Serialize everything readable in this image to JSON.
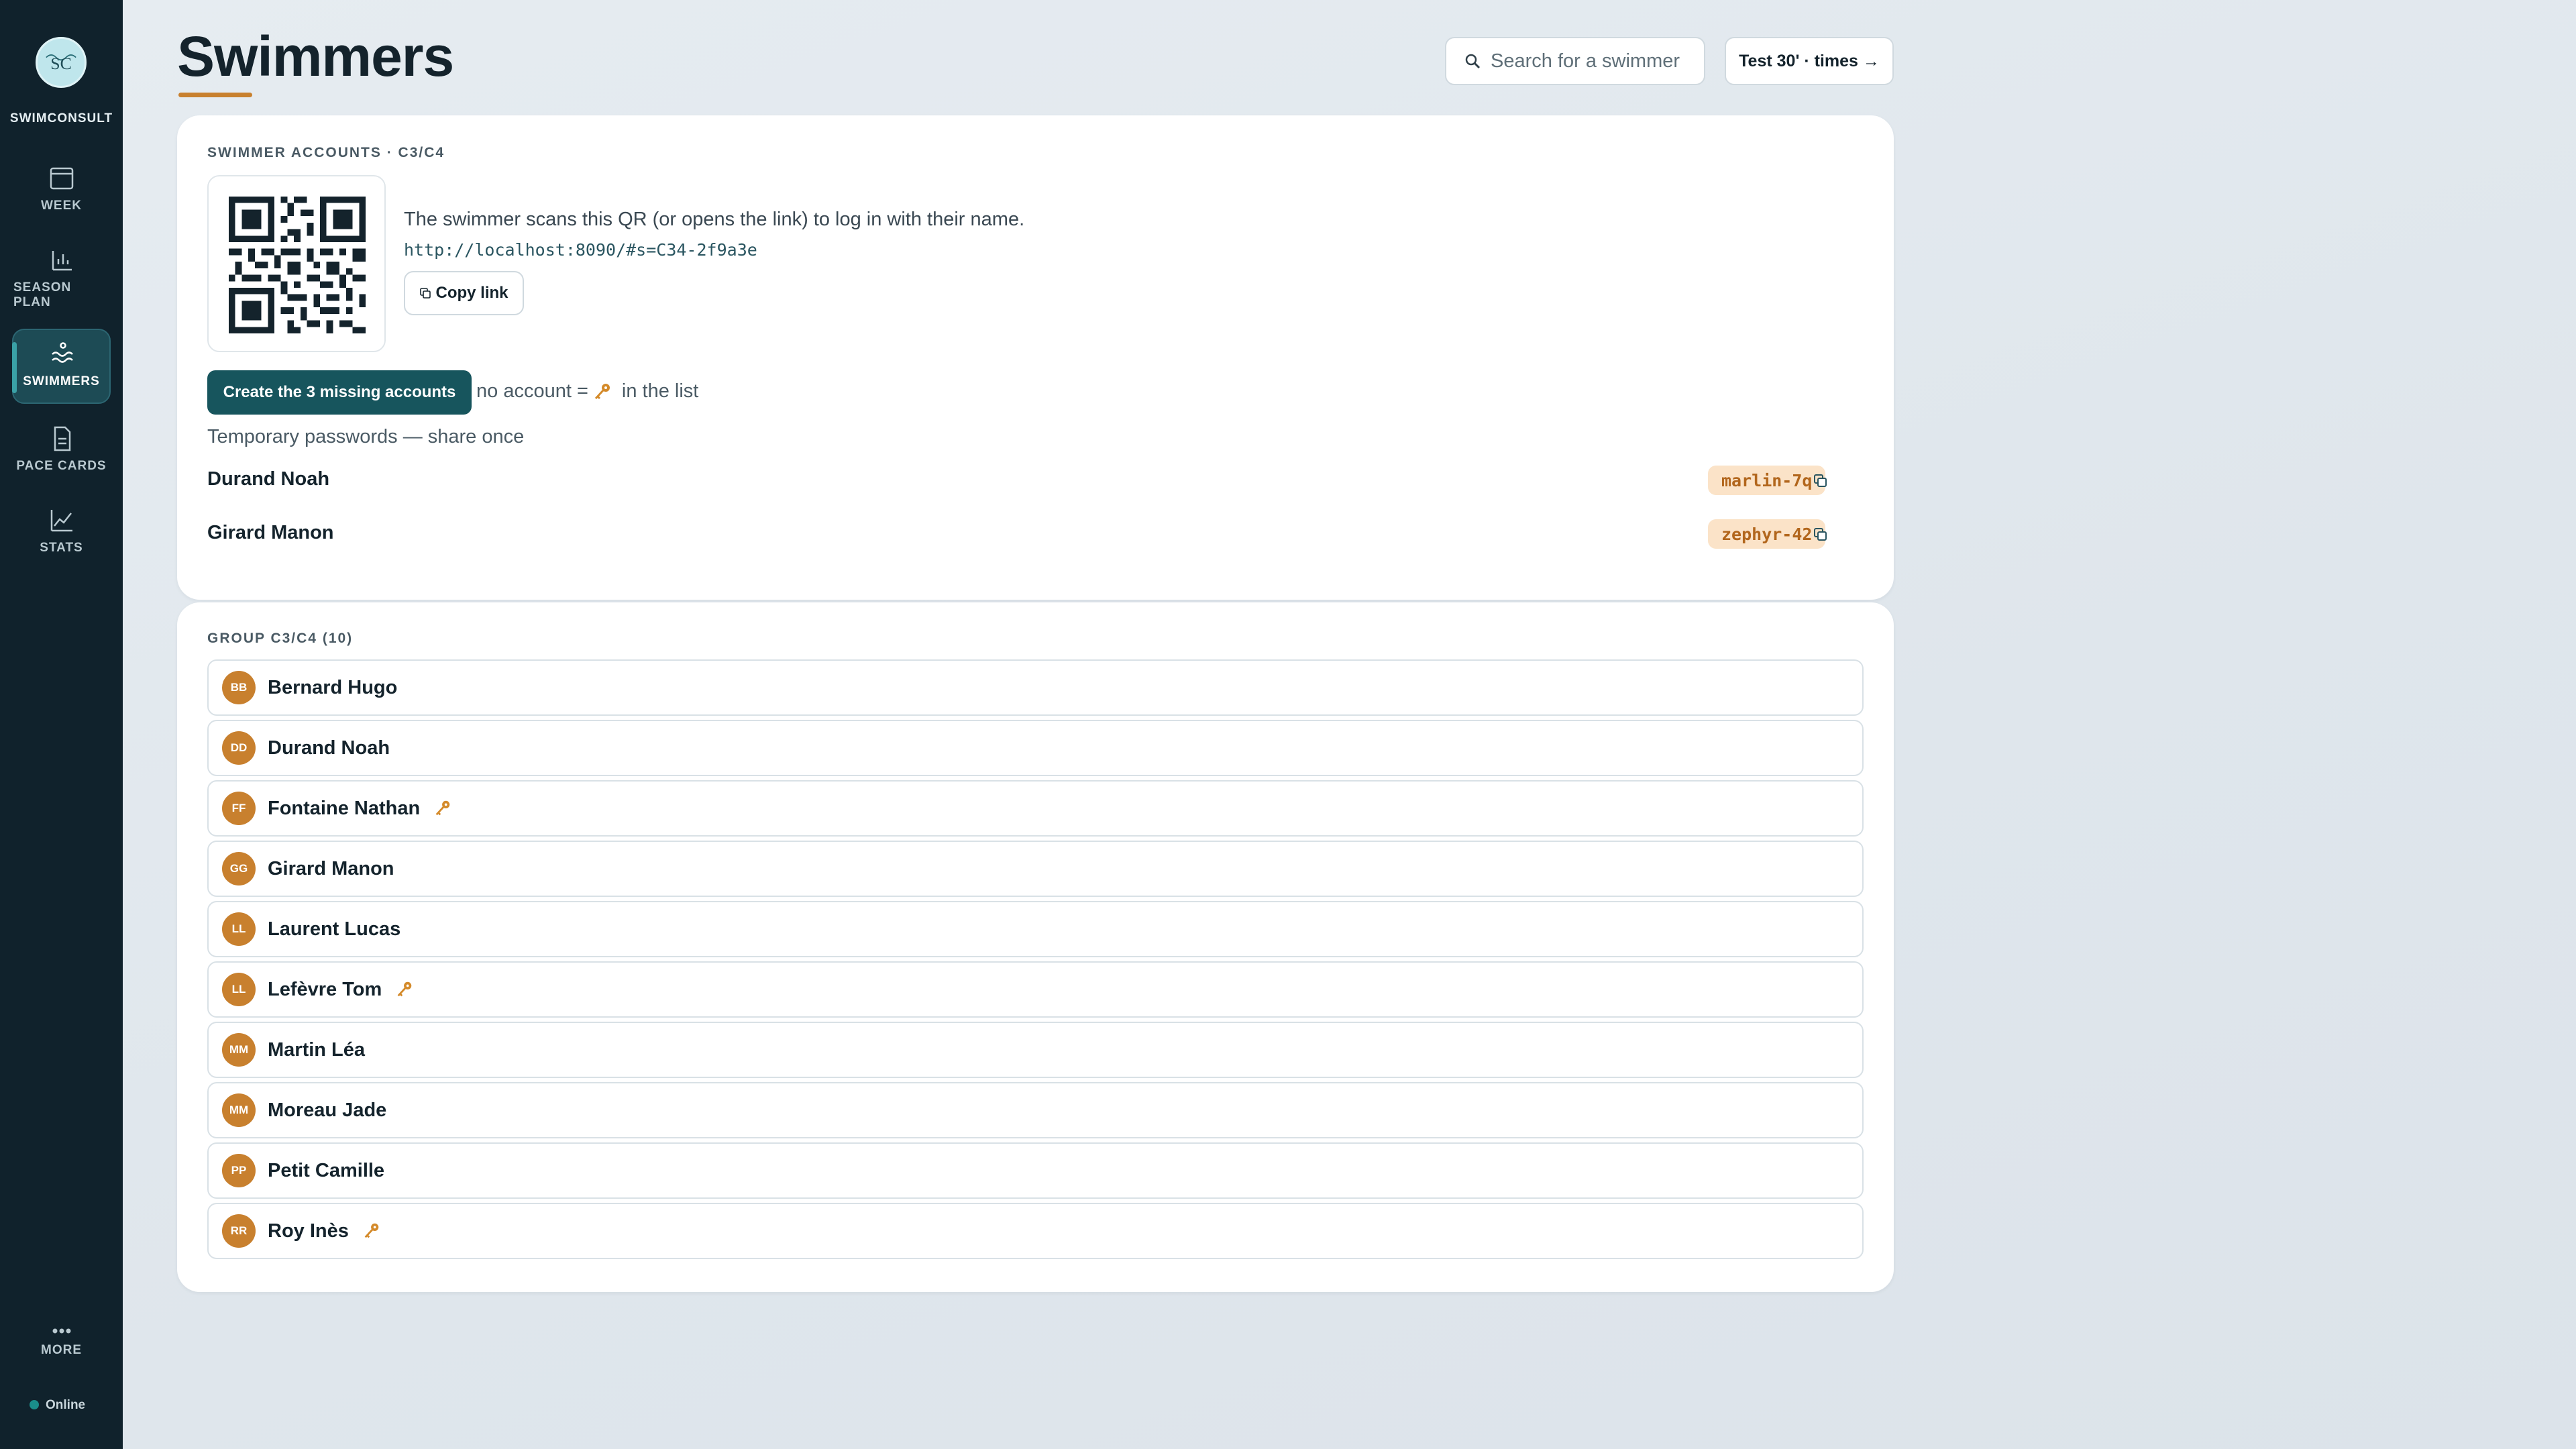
{
  "sidebar": {
    "brand": "SWIMCONSULT",
    "logo_text": "SC",
    "items": [
      {
        "label": "WEEK",
        "icon": "calendar-icon"
      },
      {
        "label": "SEASON PLAN",
        "icon": "bar-chart-icon"
      },
      {
        "label": "SWIMMERS",
        "icon": "waves-icon",
        "active": true
      },
      {
        "label": "PACE CARDS",
        "icon": "document-icon"
      },
      {
        "label": "STATS",
        "icon": "line-chart-icon"
      }
    ],
    "more_label": "MORE",
    "status": "Online"
  },
  "header": {
    "title": "Swimmers",
    "search_placeholder": "Search for a swimmer",
    "test_button": "Test 30' · times →"
  },
  "accounts": {
    "label": "SWIMMER ACCOUNTS · C3/C4",
    "description": "The swimmer scans this QR (or opens the link) to log in with their name.",
    "link": "http://localhost:8090/#s=C34-2f9a3e",
    "copy_link_label": "Copy link",
    "create_button": "Create the 3 missing accounts",
    "legend_prefix": "no account =",
    "legend_suffix": "in the list",
    "temp_passwords_label": "Temporary passwords — share once",
    "passwords": [
      {
        "name": "Durand Noah",
        "password": "marlin-7q"
      },
      {
        "name": "Girard Manon",
        "password": "zephyr-42"
      }
    ]
  },
  "group": {
    "label": "GROUP C3/C4 (10)",
    "swimmers": [
      {
        "initials": "BB",
        "name": "Bernard Hugo",
        "no_account": false
      },
      {
        "initials": "DD",
        "name": "Durand Noah",
        "no_account": false
      },
      {
        "initials": "FF",
        "name": "Fontaine Nathan",
        "no_account": true
      },
      {
        "initials": "GG",
        "name": "Girard Manon",
        "no_account": false
      },
      {
        "initials": "LL",
        "name": "Laurent Lucas",
        "no_account": false
      },
      {
        "initials": "LL",
        "name": "Lefèvre Tom",
        "no_account": true
      },
      {
        "initials": "MM",
        "name": "Martin Léa",
        "no_account": false
      },
      {
        "initials": "MM",
        "name": "Moreau Jade",
        "no_account": false
      },
      {
        "initials": "PP",
        "name": "Petit Camille",
        "no_account": false
      },
      {
        "initials": "RR",
        "name": "Roy Inès",
        "no_account": true
      }
    ]
  },
  "colors": {
    "sidebar_bg": "#10222c",
    "accent_orange": "#c8802e",
    "primary_teal": "#17555d",
    "password_bg": "#fbe3c8"
  }
}
